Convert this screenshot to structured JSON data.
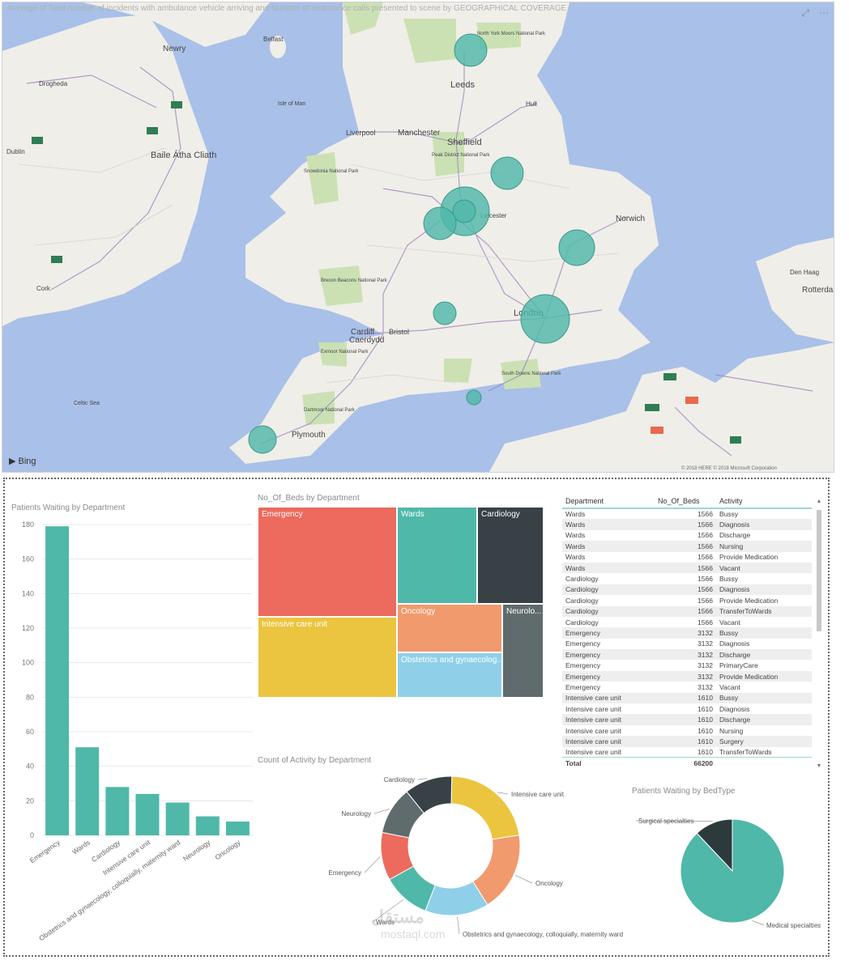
{
  "map": {
    "title": "Average of Total number of incidents with ambulance vehicle arriving and Number of ambulance calls presented to scene by GEOGRAPHICAL COVERAGE",
    "focus_icon": "focus-mode-icon",
    "more_icon": "more-options-icon",
    "bing": "Bing",
    "attribution": "© 2018 HERE  © 2018 Microsoft Corporation",
    "places": [
      "Newry",
      "Belfast",
      "Drogheda",
      "Baile Átha Cliath",
      "Dublin",
      "Cork",
      "Leeds",
      "Hull",
      "Liverpool",
      "Manchester",
      "Sheffield",
      "Leicester",
      "Norwich",
      "Cardiff",
      "Caerdydd",
      "Bristol",
      "London",
      "Plymouth",
      "Den Haag",
      "Rotterdam",
      "Isle of Man",
      "Celtic Sea",
      "Snowdonia National Park",
      "Brecon Beacons National Park",
      "Exmoor National Park",
      "Dartmoor National Park",
      "South Downs National Park",
      "North York Moors National Park",
      "Peak District National Park"
    ]
  },
  "bar_chart": {
    "title": "Patients Waiting by Department",
    "color": "#4fb8a9"
  },
  "treemap": {
    "title": "No_Of_Beds by Department",
    "cells": [
      {
        "label": "Emergency",
        "color": "#ec6a5e"
      },
      {
        "label": "Wards",
        "color": "#4fb8a9"
      },
      {
        "label": "Cardiology",
        "color": "#384246"
      },
      {
        "label": "Intensive care unit",
        "color": "#ebc540"
      },
      {
        "label": "Oncology",
        "color": "#f19a6d"
      },
      {
        "label": "Neurolo...",
        "color": "#5f6b6d"
      },
      {
        "label": "Obstetrics and gynaecolog...",
        "color": "#8fd0e8"
      }
    ]
  },
  "table": {
    "headers": [
      "Department",
      "No_Of_Beds",
      "Activity"
    ],
    "rows": [
      [
        "Wards",
        "1566",
        "Bussy"
      ],
      [
        "Wards",
        "1566",
        "Diagnosis"
      ],
      [
        "Wards",
        "1566",
        "Discharge"
      ],
      [
        "Wards",
        "1566",
        "Nursing"
      ],
      [
        "Wards",
        "1566",
        "Provide Medication"
      ],
      [
        "Wards",
        "1566",
        "Vacant"
      ],
      [
        "Cardiology",
        "1566",
        "Bussy"
      ],
      [
        "Cardiology",
        "1566",
        "Diagnosis"
      ],
      [
        "Cardiology",
        "1566",
        "Provide Medication"
      ],
      [
        "Cardiology",
        "1566",
        "TransferToWards"
      ],
      [
        "Cardiology",
        "1566",
        "Vacant"
      ],
      [
        "Emergency",
        "3132",
        "Bussy"
      ],
      [
        "Emergency",
        "3132",
        "Diagnosis"
      ],
      [
        "Emergency",
        "3132",
        "Discharge"
      ],
      [
        "Emergency",
        "3132",
        "PrimaryCare"
      ],
      [
        "Emergency",
        "3132",
        "Provide Medication"
      ],
      [
        "Emergency",
        "3132",
        "Vacant"
      ],
      [
        "Intensive care unit",
        "1610",
        "Bussy"
      ],
      [
        "Intensive care unit",
        "1610",
        "Diagnosis"
      ],
      [
        "Intensive care unit",
        "1610",
        "Discharge"
      ],
      [
        "Intensive care unit",
        "1610",
        "Nursing"
      ],
      [
        "Intensive care unit",
        "1610",
        "Surgery"
      ],
      [
        "Intensive care unit",
        "1610",
        "TransferToWards"
      ]
    ],
    "total_label": "Total",
    "total_value": "66200"
  },
  "donut": {
    "title": "Count of Activity by Department"
  },
  "pie": {
    "title": "Patients Waiting by BedType"
  },
  "watermark": {
    "arabic": "مستقل",
    "latin": "mostaql.com"
  },
  "chart_data": [
    {
      "type": "bar",
      "title": "Patients Waiting by Department",
      "categories": [
        "Emergency",
        "Wards",
        "Cardiology",
        "Intensive care unit",
        "Obstetrics and gynaecology, colloquially, maternity ward",
        "Neurology",
        "Oncology"
      ],
      "values": [
        179,
        51,
        28,
        24,
        19,
        11,
        8
      ],
      "ylim": [
        0,
        180
      ],
      "yticks": [
        0,
        20,
        40,
        60,
        80,
        100,
        120,
        140,
        160,
        180
      ],
      "grid": true,
      "color": "#4fb8a9"
    },
    {
      "type": "treemap",
      "title": "No_Of_Beds by Department",
      "categories": [
        "Emergency",
        "Wards",
        "Cardiology",
        "Intensive care unit",
        "Oncology",
        "Neurology",
        "Obstetrics and gynaecology"
      ],
      "values": [
        18792,
        9396,
        7830,
        9660,
        6264,
        4698,
        6264
      ]
    },
    {
      "type": "pie",
      "subtype": "donut",
      "title": "Count of Activity by Department",
      "categories": [
        "Intensive care unit",
        "Oncology",
        "Obstetrics and gynaecology, colloquially, maternity ward",
        "Wards",
        "Emergency",
        "Neurology",
        "Cardiology"
      ],
      "values": [
        6,
        5,
        4,
        3,
        3,
        3,
        3
      ],
      "colors": [
        "#ebc540",
        "#f19a6d",
        "#8fd0e8",
        "#4fb8a9",
        "#ec6a5e",
        "#5f6b6d",
        "#384246"
      ]
    },
    {
      "type": "pie",
      "title": "Patients Waiting by BedType",
      "categories": [
        "Medical specialties",
        "Surgical specialties"
      ],
      "values": [
        88,
        12
      ],
      "colors": [
        "#4fb8a9",
        "#2c3a3c"
      ]
    }
  ]
}
